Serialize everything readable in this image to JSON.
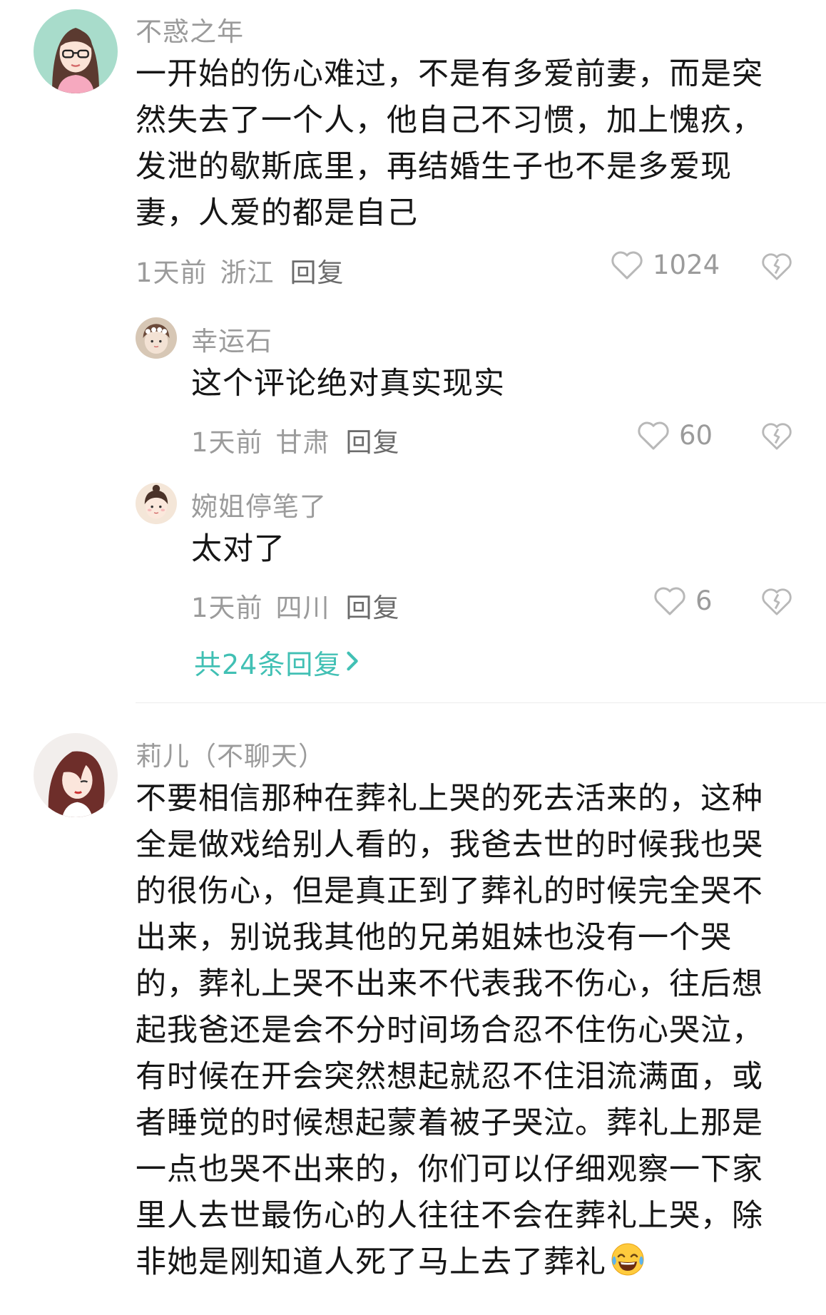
{
  "comments": [
    {
      "username": "不惑之年",
      "text_lines": [
        "一开始的伤心难过，不是有多爱前妻，而是突",
        "然失去了一个人，他自己不习惯，加上愧疚，",
        "发泄的歇斯底里，再结婚生子也不是多爱现",
        "妻，人爱的都是自己"
      ],
      "time": "1天前",
      "location": "浙江",
      "reply_label": "回复",
      "likes": "1024",
      "replies": [
        {
          "username": "幸运石",
          "text": "这个评论绝对真实现实",
          "time": "1天前",
          "location": "甘肃",
          "reply_label": "回复",
          "likes": "60"
        },
        {
          "username": "婉姐停笔了",
          "text": "太对了",
          "time": "1天前",
          "location": "四川",
          "reply_label": "回复",
          "likes": "6"
        }
      ],
      "more_replies_label": "共24条回复"
    },
    {
      "username": "莉儿（不聊天）",
      "text_lines": [
        "不要相信那种在葬礼上哭的死去活来的，这种",
        "全是做戏给别人看的，我爸去世的时候我也哭",
        "的很伤心，但是真正到了葬礼的时候完全哭不",
        "出来，别说我其他的兄弟姐妹也没有一个哭",
        "的，葬礼上哭不出来不代表我不伤心，往后想",
        "起我爸还是会不分时间场合忍不住伤心哭泣，",
        "有时候在开会突然想起就忍不住泪流满面，或",
        "者睡觉的时候想起蒙着被子哭泣。葬礼上那是",
        "一点也哭不出来的，你们可以仔细观察一下家",
        "里人去世最伤心的人往往不会在葬礼上哭，除",
        "非她是刚知道人死了马上去了葬礼"
      ],
      "trailing_emoji": "tears-of-joy-emoji"
    }
  ],
  "icons": {
    "like": "heart-outline-icon",
    "dislike": "broken-heart-icon",
    "more_replies": "chevron-right-icon"
  },
  "colors": {
    "accent": "#41c0b4",
    "secondary_text": "#9b9b9b",
    "primary_text": "#161616"
  }
}
